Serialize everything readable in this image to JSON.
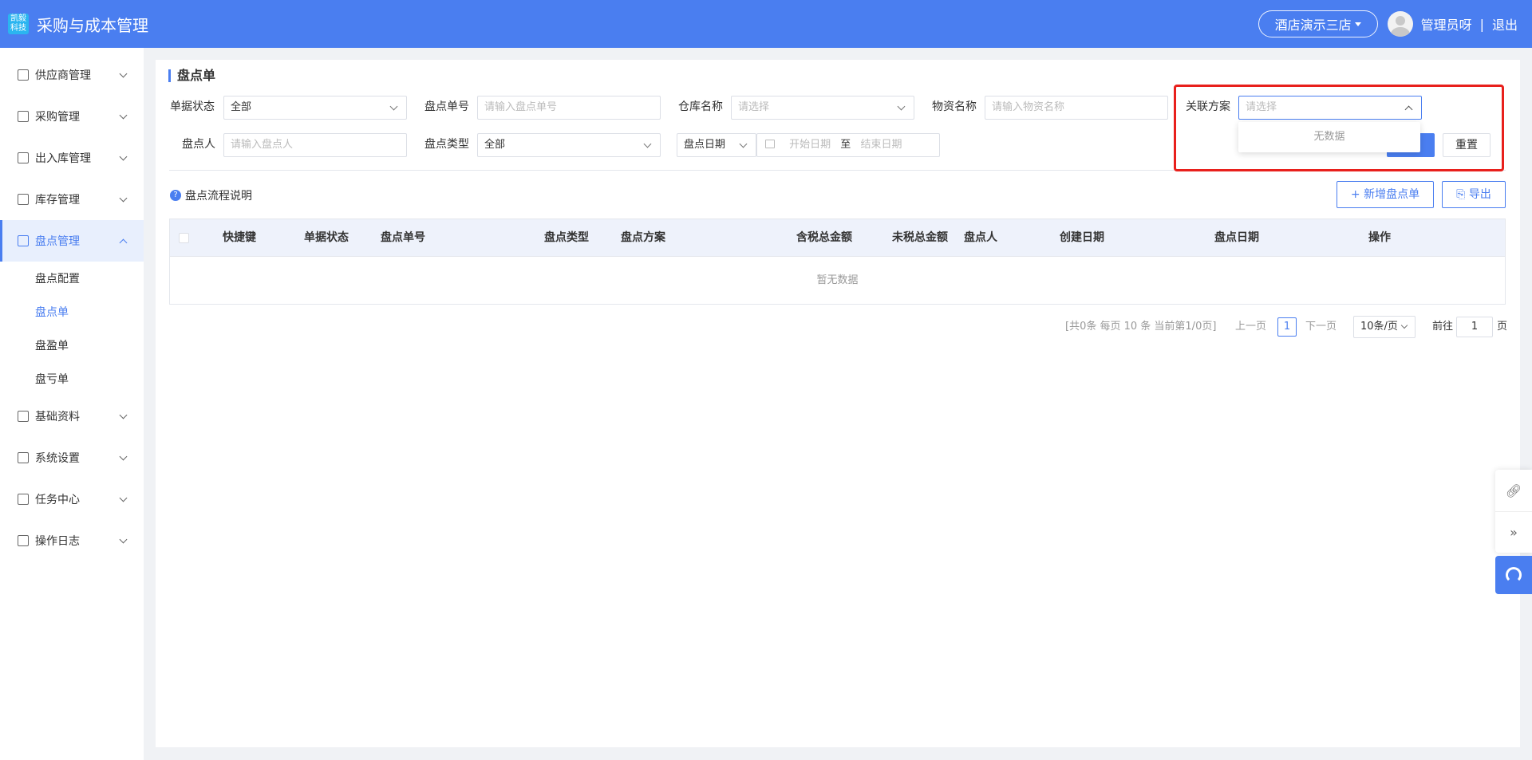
{
  "header": {
    "logo_top": "凯毅",
    "logo_bottom": "科技",
    "title": "采购与成本管理",
    "store": "酒店演示三店",
    "user": "管理员呀",
    "separator": "|",
    "logout": "退出"
  },
  "sidebar": {
    "items": [
      {
        "label": "供应商管理",
        "icon": "supplier-icon"
      },
      {
        "label": "采购管理",
        "icon": "purchase-icon"
      },
      {
        "label": "出入库管理",
        "icon": "inout-icon"
      },
      {
        "label": "库存管理",
        "icon": "inventory-icon"
      },
      {
        "label": "盘点管理",
        "icon": "stocktake-icon",
        "expanded": true,
        "children": [
          "盘点配置",
          "盘点单",
          "盘盈单",
          "盘亏单"
        ],
        "active_child": "盘点单"
      },
      {
        "label": "基础资料",
        "icon": "basic-data-icon"
      },
      {
        "label": "系统设置",
        "icon": "settings-icon"
      },
      {
        "label": "任务中心",
        "icon": "task-icon"
      },
      {
        "label": "操作日志",
        "icon": "log-icon"
      }
    ]
  },
  "page": {
    "title": "盘点单"
  },
  "filters": {
    "status_label": "单据状态",
    "status_value": "全部",
    "order_no_label": "盘点单号",
    "order_no_placeholder": "请输入盘点单号",
    "warehouse_label": "仓库名称",
    "warehouse_placeholder": "请选择",
    "material_label": "物资名称",
    "material_placeholder": "请输入物资名称",
    "scheme_label": "关联方案",
    "scheme_placeholder": "请选择",
    "scheme_dropdown_empty": "无数据",
    "person_label": "盘点人",
    "person_placeholder": "请输入盘点人",
    "type_label": "盘点类型",
    "type_value": "全部",
    "date_type_value": "盘点日期",
    "start_placeholder": "开始日期",
    "range_sep": "至",
    "end_placeholder": "结束日期",
    "reset_label": "重置"
  },
  "toolbar": {
    "help_text": "盘点流程说明",
    "add_label": "新增盘点单",
    "export_label": "导出"
  },
  "table": {
    "columns": [
      "快捷键",
      "单据状态",
      "盘点单号",
      "盘点类型",
      "盘点方案",
      "含税总金额",
      "未税总金额",
      "盘点人",
      "创建日期",
      "盘点日期",
      "操作"
    ],
    "empty_text": "暂无数据"
  },
  "pagination": {
    "summary": "[共0条 每页 10 条 当前第1/0页]",
    "prev": "上一页",
    "current": "1",
    "next": "下一页",
    "page_size": "10条/页",
    "goto_label": "前往",
    "goto_value": "1",
    "page_unit": "页"
  },
  "colors": {
    "primary": "#4a7ef0",
    "highlight_frame": "#e8201c"
  }
}
